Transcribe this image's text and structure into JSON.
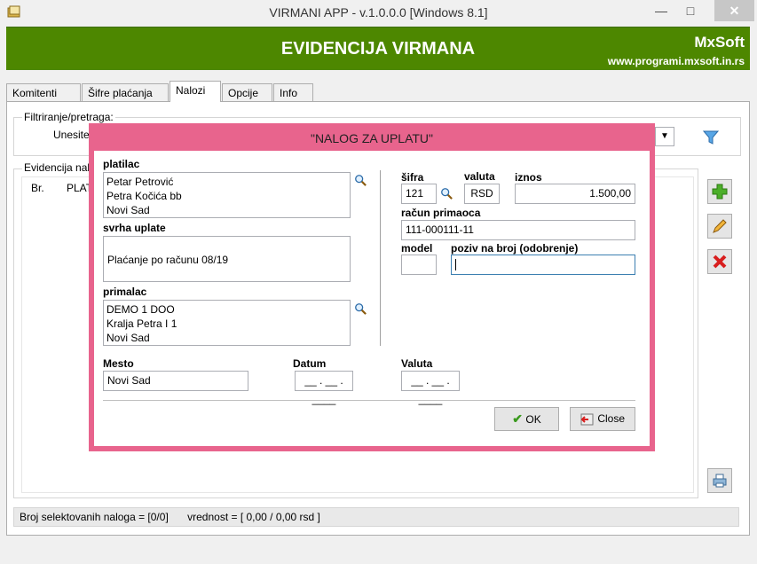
{
  "window": {
    "title": "VIRMANI APP - v.1.0.0.0  [Windows 8.1]",
    "minimize": "—",
    "maximize": "□",
    "close": "✕"
  },
  "header": {
    "title": "EVIDENCIJA VIRMANA",
    "brand": "MxSoft",
    "site": "www.programi.mxsoft.in.rs"
  },
  "tabs": [
    {
      "label": "Komitenti"
    },
    {
      "label": "Šifre plaćanja"
    },
    {
      "label": "Nalozi"
    },
    {
      "label": "Opcije"
    },
    {
      "label": "Info"
    }
  ],
  "filter": {
    "group_label": "Filtriranje/pretraga:",
    "search_label": "Unesite"
  },
  "list": {
    "group_label": "Evidencija nal",
    "columns": [
      "Br.",
      "PLAT"
    ]
  },
  "status": {
    "selected": "Broj selektovanih naloga = [0/0]",
    "value": "vrednost = [ 0,00 / 0,00 rsd ]"
  },
  "dialog": {
    "title": "\"NALOG ZA UPLATU\"",
    "platilac_label": "platilac",
    "platilac_lines": [
      "Petar Petrović",
      "Petra Kočića bb",
      "Novi Sad"
    ],
    "svrha_label": "svrha uplate",
    "svrha_value": "Plaćanje po računu 08/19",
    "primalac_label": "primalac",
    "primalac_lines": [
      "DEMO 1 DOO",
      "Kralja Petra I 1",
      "Novi Sad"
    ],
    "sifra_label": "šifra",
    "sifra_value": "121",
    "valuta_label": "valuta",
    "valuta_value": "RSD",
    "iznos_label": "iznos",
    "iznos_value": "1.500,00",
    "racun_label": "račun primaoca",
    "racun_value": "111-000111-11",
    "model_label": "model",
    "model_value": "",
    "poziv_label": "poziv na broj (odobrenje)",
    "poziv_value": "",
    "mesto_label": "Mesto",
    "mesto_value": "Novi Sad",
    "datum_label": "Datum",
    "datum_value": "__ . __ . ____",
    "valuta2_label": "Valuta",
    "valuta2_value": "__ . __ . ____",
    "ok_label": "OK",
    "close_label": "Close"
  },
  "colors": {
    "header": "#4d8700",
    "dialog_frame": "#e8648d"
  }
}
